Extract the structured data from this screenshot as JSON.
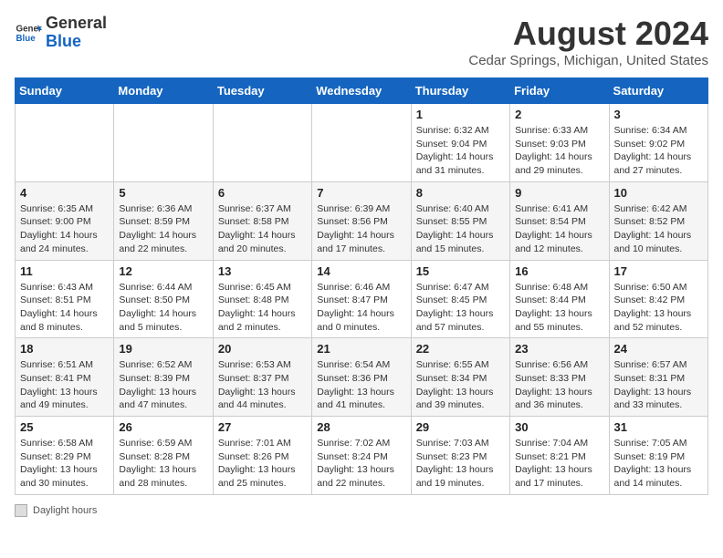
{
  "header": {
    "logo_general": "General",
    "logo_blue": "Blue",
    "title": "August 2024",
    "location": "Cedar Springs, Michigan, United States"
  },
  "days_of_week": [
    "Sunday",
    "Monday",
    "Tuesday",
    "Wednesday",
    "Thursday",
    "Friday",
    "Saturday"
  ],
  "weeks": [
    [
      {
        "day": "",
        "info": ""
      },
      {
        "day": "",
        "info": ""
      },
      {
        "day": "",
        "info": ""
      },
      {
        "day": "",
        "info": ""
      },
      {
        "day": "1",
        "info": "Sunrise: 6:32 AM\nSunset: 9:04 PM\nDaylight: 14 hours and 31 minutes."
      },
      {
        "day": "2",
        "info": "Sunrise: 6:33 AM\nSunset: 9:03 PM\nDaylight: 14 hours and 29 minutes."
      },
      {
        "day": "3",
        "info": "Sunrise: 6:34 AM\nSunset: 9:02 PM\nDaylight: 14 hours and 27 minutes."
      }
    ],
    [
      {
        "day": "4",
        "info": "Sunrise: 6:35 AM\nSunset: 9:00 PM\nDaylight: 14 hours and 24 minutes."
      },
      {
        "day": "5",
        "info": "Sunrise: 6:36 AM\nSunset: 8:59 PM\nDaylight: 14 hours and 22 minutes."
      },
      {
        "day": "6",
        "info": "Sunrise: 6:37 AM\nSunset: 8:58 PM\nDaylight: 14 hours and 20 minutes."
      },
      {
        "day": "7",
        "info": "Sunrise: 6:39 AM\nSunset: 8:56 PM\nDaylight: 14 hours and 17 minutes."
      },
      {
        "day": "8",
        "info": "Sunrise: 6:40 AM\nSunset: 8:55 PM\nDaylight: 14 hours and 15 minutes."
      },
      {
        "day": "9",
        "info": "Sunrise: 6:41 AM\nSunset: 8:54 PM\nDaylight: 14 hours and 12 minutes."
      },
      {
        "day": "10",
        "info": "Sunrise: 6:42 AM\nSunset: 8:52 PM\nDaylight: 14 hours and 10 minutes."
      }
    ],
    [
      {
        "day": "11",
        "info": "Sunrise: 6:43 AM\nSunset: 8:51 PM\nDaylight: 14 hours and 8 minutes."
      },
      {
        "day": "12",
        "info": "Sunrise: 6:44 AM\nSunset: 8:50 PM\nDaylight: 14 hours and 5 minutes."
      },
      {
        "day": "13",
        "info": "Sunrise: 6:45 AM\nSunset: 8:48 PM\nDaylight: 14 hours and 2 minutes."
      },
      {
        "day": "14",
        "info": "Sunrise: 6:46 AM\nSunset: 8:47 PM\nDaylight: 14 hours and 0 minutes."
      },
      {
        "day": "15",
        "info": "Sunrise: 6:47 AM\nSunset: 8:45 PM\nDaylight: 13 hours and 57 minutes."
      },
      {
        "day": "16",
        "info": "Sunrise: 6:48 AM\nSunset: 8:44 PM\nDaylight: 13 hours and 55 minutes."
      },
      {
        "day": "17",
        "info": "Sunrise: 6:50 AM\nSunset: 8:42 PM\nDaylight: 13 hours and 52 minutes."
      }
    ],
    [
      {
        "day": "18",
        "info": "Sunrise: 6:51 AM\nSunset: 8:41 PM\nDaylight: 13 hours and 49 minutes."
      },
      {
        "day": "19",
        "info": "Sunrise: 6:52 AM\nSunset: 8:39 PM\nDaylight: 13 hours and 47 minutes."
      },
      {
        "day": "20",
        "info": "Sunrise: 6:53 AM\nSunset: 8:37 PM\nDaylight: 13 hours and 44 minutes."
      },
      {
        "day": "21",
        "info": "Sunrise: 6:54 AM\nSunset: 8:36 PM\nDaylight: 13 hours and 41 minutes."
      },
      {
        "day": "22",
        "info": "Sunrise: 6:55 AM\nSunset: 8:34 PM\nDaylight: 13 hours and 39 minutes."
      },
      {
        "day": "23",
        "info": "Sunrise: 6:56 AM\nSunset: 8:33 PM\nDaylight: 13 hours and 36 minutes."
      },
      {
        "day": "24",
        "info": "Sunrise: 6:57 AM\nSunset: 8:31 PM\nDaylight: 13 hours and 33 minutes."
      }
    ],
    [
      {
        "day": "25",
        "info": "Sunrise: 6:58 AM\nSunset: 8:29 PM\nDaylight: 13 hours and 30 minutes."
      },
      {
        "day": "26",
        "info": "Sunrise: 6:59 AM\nSunset: 8:28 PM\nDaylight: 13 hours and 28 minutes."
      },
      {
        "day": "27",
        "info": "Sunrise: 7:01 AM\nSunset: 8:26 PM\nDaylight: 13 hours and 25 minutes."
      },
      {
        "day": "28",
        "info": "Sunrise: 7:02 AM\nSunset: 8:24 PM\nDaylight: 13 hours and 22 minutes."
      },
      {
        "day": "29",
        "info": "Sunrise: 7:03 AM\nSunset: 8:23 PM\nDaylight: 13 hours and 19 minutes."
      },
      {
        "day": "30",
        "info": "Sunrise: 7:04 AM\nSunset: 8:21 PM\nDaylight: 13 hours and 17 minutes."
      },
      {
        "day": "31",
        "info": "Sunrise: 7:05 AM\nSunset: 8:19 PM\nDaylight: 13 hours and 14 minutes."
      }
    ]
  ],
  "footer": {
    "label": "Daylight hours"
  }
}
